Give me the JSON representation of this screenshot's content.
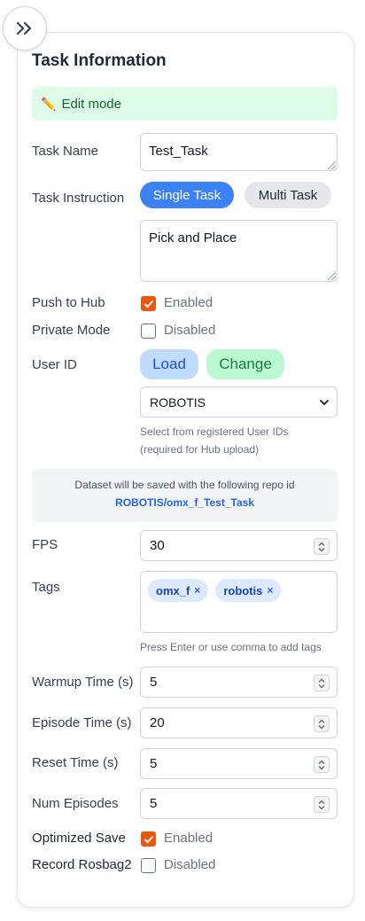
{
  "panel": {
    "title": "Task Information",
    "edit_mode": "Edit mode"
  },
  "task_name": {
    "label": "Task Name",
    "value": "Test_Task"
  },
  "task_instruction": {
    "label": "Task Instruction",
    "single_label": "Single Task",
    "multi_label": "Multi Task",
    "selected": "Single Task",
    "value": "Pick and Place"
  },
  "push_to_hub": {
    "label": "Push to Hub",
    "checked": true,
    "status": "Enabled"
  },
  "private_mode": {
    "label": "Private Mode",
    "checked": false,
    "status": "Disabled"
  },
  "user_id": {
    "label": "User ID",
    "load_label": "Load",
    "change_label": "Change",
    "selected": "ROBOTIS",
    "helper_line1": "Select from registered User IDs",
    "helper_line2": "(required for Hub upload)"
  },
  "repo_info": {
    "text": "Dataset will be saved with the following repo id",
    "repo_id": "ROBOTIS/omx_f_Test_Task"
  },
  "fps": {
    "label": "FPS",
    "value": "30"
  },
  "tags": {
    "label": "Tags",
    "items": [
      "omx_f",
      "robotis"
    ],
    "remove_glyph": "×",
    "helper": "Press Enter or use comma to add tags"
  },
  "warmup_time": {
    "label": "Warmup Time (s)",
    "value": "5"
  },
  "episode_time": {
    "label": "Episode Time (s)",
    "value": "20"
  },
  "reset_time": {
    "label": "Reset Time (s)",
    "value": "5"
  },
  "num_episodes": {
    "label": "Num Episodes",
    "value": "5"
  },
  "optimized_save": {
    "label": "Optimized Save",
    "checked": true,
    "status": "Enabled"
  },
  "record_rosbag2": {
    "label": "Record Rosbag2",
    "checked": false,
    "status": "Disabled"
  },
  "colors": {
    "accent": "#3b82f6",
    "checkbox_on": "#ea580c",
    "edit_bg": "#dcfce7"
  }
}
